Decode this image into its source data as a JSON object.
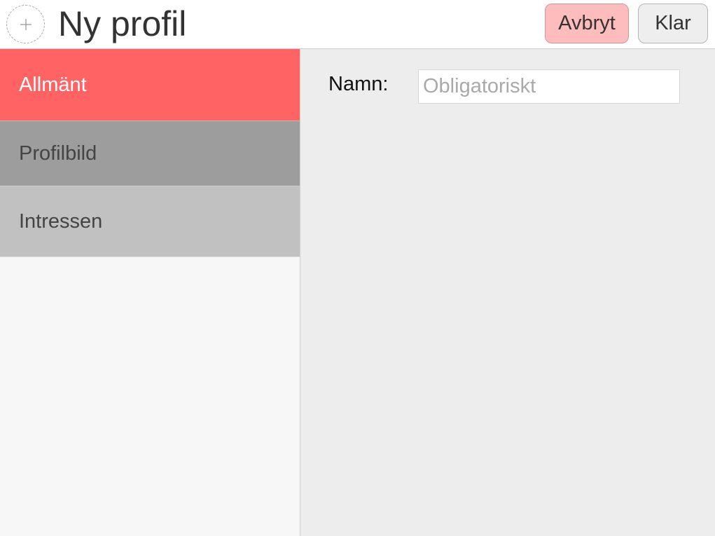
{
  "header": {
    "title": "Ny profil",
    "avatar_icon": "plus-icon",
    "cancel_label": "Avbryt",
    "done_label": "Klar"
  },
  "sidebar": {
    "items": [
      {
        "label": "Allmänt",
        "selected": true
      },
      {
        "label": "Profilbild",
        "selected": false
      },
      {
        "label": "Intressen",
        "selected": false
      }
    ]
  },
  "form": {
    "name_label": "Namn:",
    "name_value": "",
    "name_placeholder": "Obligatoriskt"
  },
  "colors": {
    "accent_selected": "#ff6363",
    "cancel_button": "#ffbcbc",
    "done_button": "#eeeeee"
  }
}
